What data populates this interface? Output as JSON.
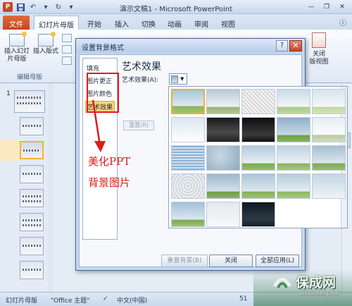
{
  "window": {
    "title": "演示文稿1 - Microsoft PowerPoint",
    "app_icon_letter": "P",
    "controls": [
      "—",
      "❐",
      "✕"
    ]
  },
  "ribbon": {
    "tabs": [
      "文件",
      "幻灯片母版",
      "开始",
      "插入",
      "切换",
      "动画",
      "审阅",
      "视图"
    ],
    "active_tab": "幻灯片母版",
    "insert_master_label": "插入幻灯片母版",
    "insert_layout_label": "插入版式",
    "group_edit_master": "编辑母版",
    "close_label": "关闭",
    "master_view_label": "版视图"
  },
  "slide_panel": {
    "first_number": "1"
  },
  "status_bar": {
    "view": "幻灯片母版",
    "theme": "\"Office 主题\"",
    "language": "中文(中国)",
    "zoom_partial": "51"
  },
  "dialog": {
    "title": "设置背景格式",
    "help": "?",
    "close": "✕",
    "categories": [
      "填充",
      "图片更正",
      "图片颜色",
      "艺术效果"
    ],
    "selected_category": "艺术效果",
    "heading": "艺术效果",
    "effect_label": "艺术效果(A):",
    "reset_small": "重置(R)",
    "buttons": {
      "reset_background": "重置背景(B)",
      "close": "关闭",
      "apply_all": "全部应用(L)"
    },
    "gallery_tile_count": 23,
    "selected_tile": 1
  },
  "annotations": {
    "line1": "美化PPT",
    "line2": "背景图片",
    "color": "#e01b1b"
  },
  "watermark": {
    "text": "保成网",
    "url": "zsbaocheng.net"
  },
  "colors": {
    "accent_file_tab": "#c7461e",
    "selection": "#f8d37a",
    "dialog_frame": "#48689b"
  }
}
